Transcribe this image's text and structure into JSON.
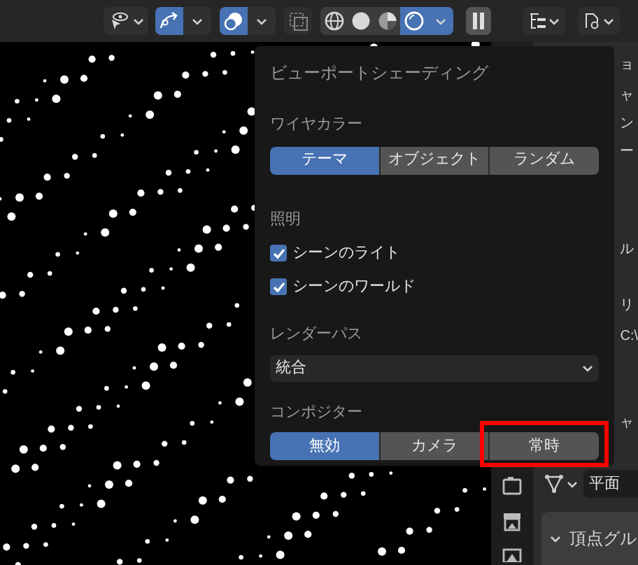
{
  "header": {
    "gizmo_on": true,
    "overlay_on": true,
    "xray_on": false,
    "shading_modes": [
      {
        "kind": "wireframe",
        "selected": false
      },
      {
        "kind": "solid",
        "selected": false
      },
      {
        "kind": "material",
        "selected": false
      },
      {
        "kind": "rendered",
        "selected": true
      }
    ]
  },
  "popup": {
    "title": "ビューポートシェーディング",
    "wire_color": {
      "label": "ワイヤカラー",
      "options": [
        {
          "label": "テーマ",
          "selected": true
        },
        {
          "label": "オブジェクト",
          "selected": false
        },
        {
          "label": "ランダム",
          "selected": false
        }
      ]
    },
    "lighting": {
      "label": "照明",
      "checkboxes": [
        {
          "label": "シーンのライト",
          "checked": true
        },
        {
          "label": "シーンのワールド",
          "checked": true
        }
      ]
    },
    "render_pass": {
      "label": "レンダーパス",
      "value": "統合"
    },
    "compositor": {
      "label": "コンポジター",
      "options": [
        {
          "label": "無効",
          "selected": true,
          "highlighted": false
        },
        {
          "label": "カメラ",
          "selected": false,
          "highlighted": false
        },
        {
          "label": "常時",
          "selected": false,
          "highlighted": true
        }
      ]
    }
  },
  "properties": {
    "fragments": [
      "ョ",
      "ャ",
      "ン",
      "ー",
      "ル",
      "リ",
      "C:\\",
      "ャ"
    ],
    "mesh_field": "平面",
    "vertex_groups": "頂点グル"
  }
}
